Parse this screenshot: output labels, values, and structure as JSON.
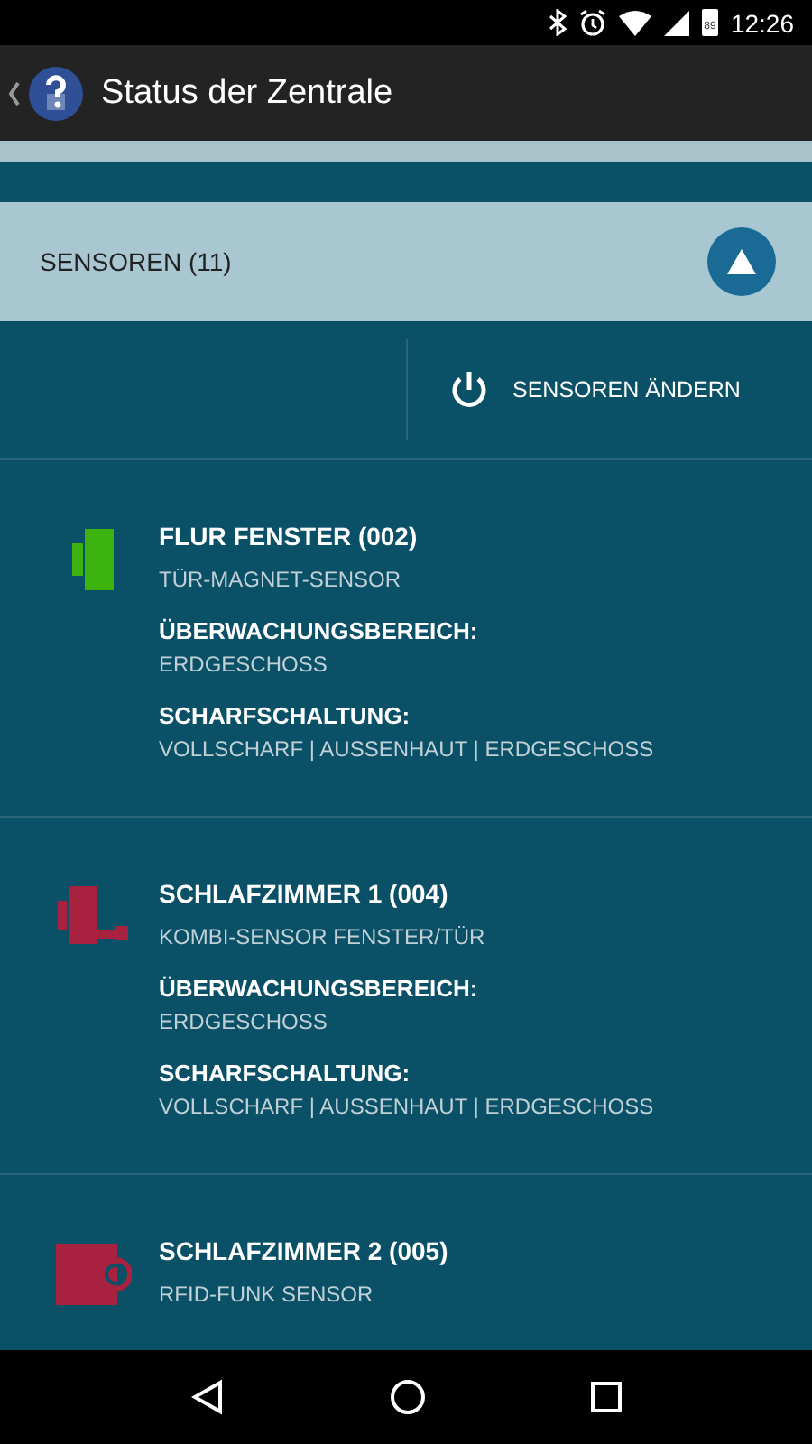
{
  "status_bar": {
    "time": "12:26",
    "battery": "89"
  },
  "app_bar": {
    "title": "Status der Zentrale"
  },
  "section": {
    "title": "SENSOREN (11)",
    "expanded": true
  },
  "action": {
    "label": "SENSOREN ÄNDERN"
  },
  "sensors": [
    {
      "kind": "magnet",
      "color": "#3cb30f",
      "name": "FLUR FENSTER (002)",
      "type": "TÜR-MAGNET-SENSOR",
      "area_label": "ÜBERWACHUNGSBEREICH:",
      "area": "ERDGESCHOSS",
      "arming_label": "SCHARFSCHALTUNG:",
      "arming": "VOLLSCHARF | AUSSENHAUT | ERDGESCHOSS"
    },
    {
      "kind": "combi",
      "color": "#a8223f",
      "name": "SCHLAFZIMMER 1 (004)",
      "type": "KOMBI-SENSOR FENSTER/TÜR",
      "area_label": "ÜBERWACHUNGSBEREICH:",
      "area": "ERDGESCHOSS",
      "arming_label": "SCHARFSCHALTUNG:",
      "arming": "VOLLSCHARF | AUSSENHAUT | ERDGESCHOSS"
    },
    {
      "kind": "rfid",
      "color": "#a8223f",
      "name": "SCHLAFZIMMER 2 (005)",
      "type": "RFID-FUNK SENSOR"
    }
  ]
}
